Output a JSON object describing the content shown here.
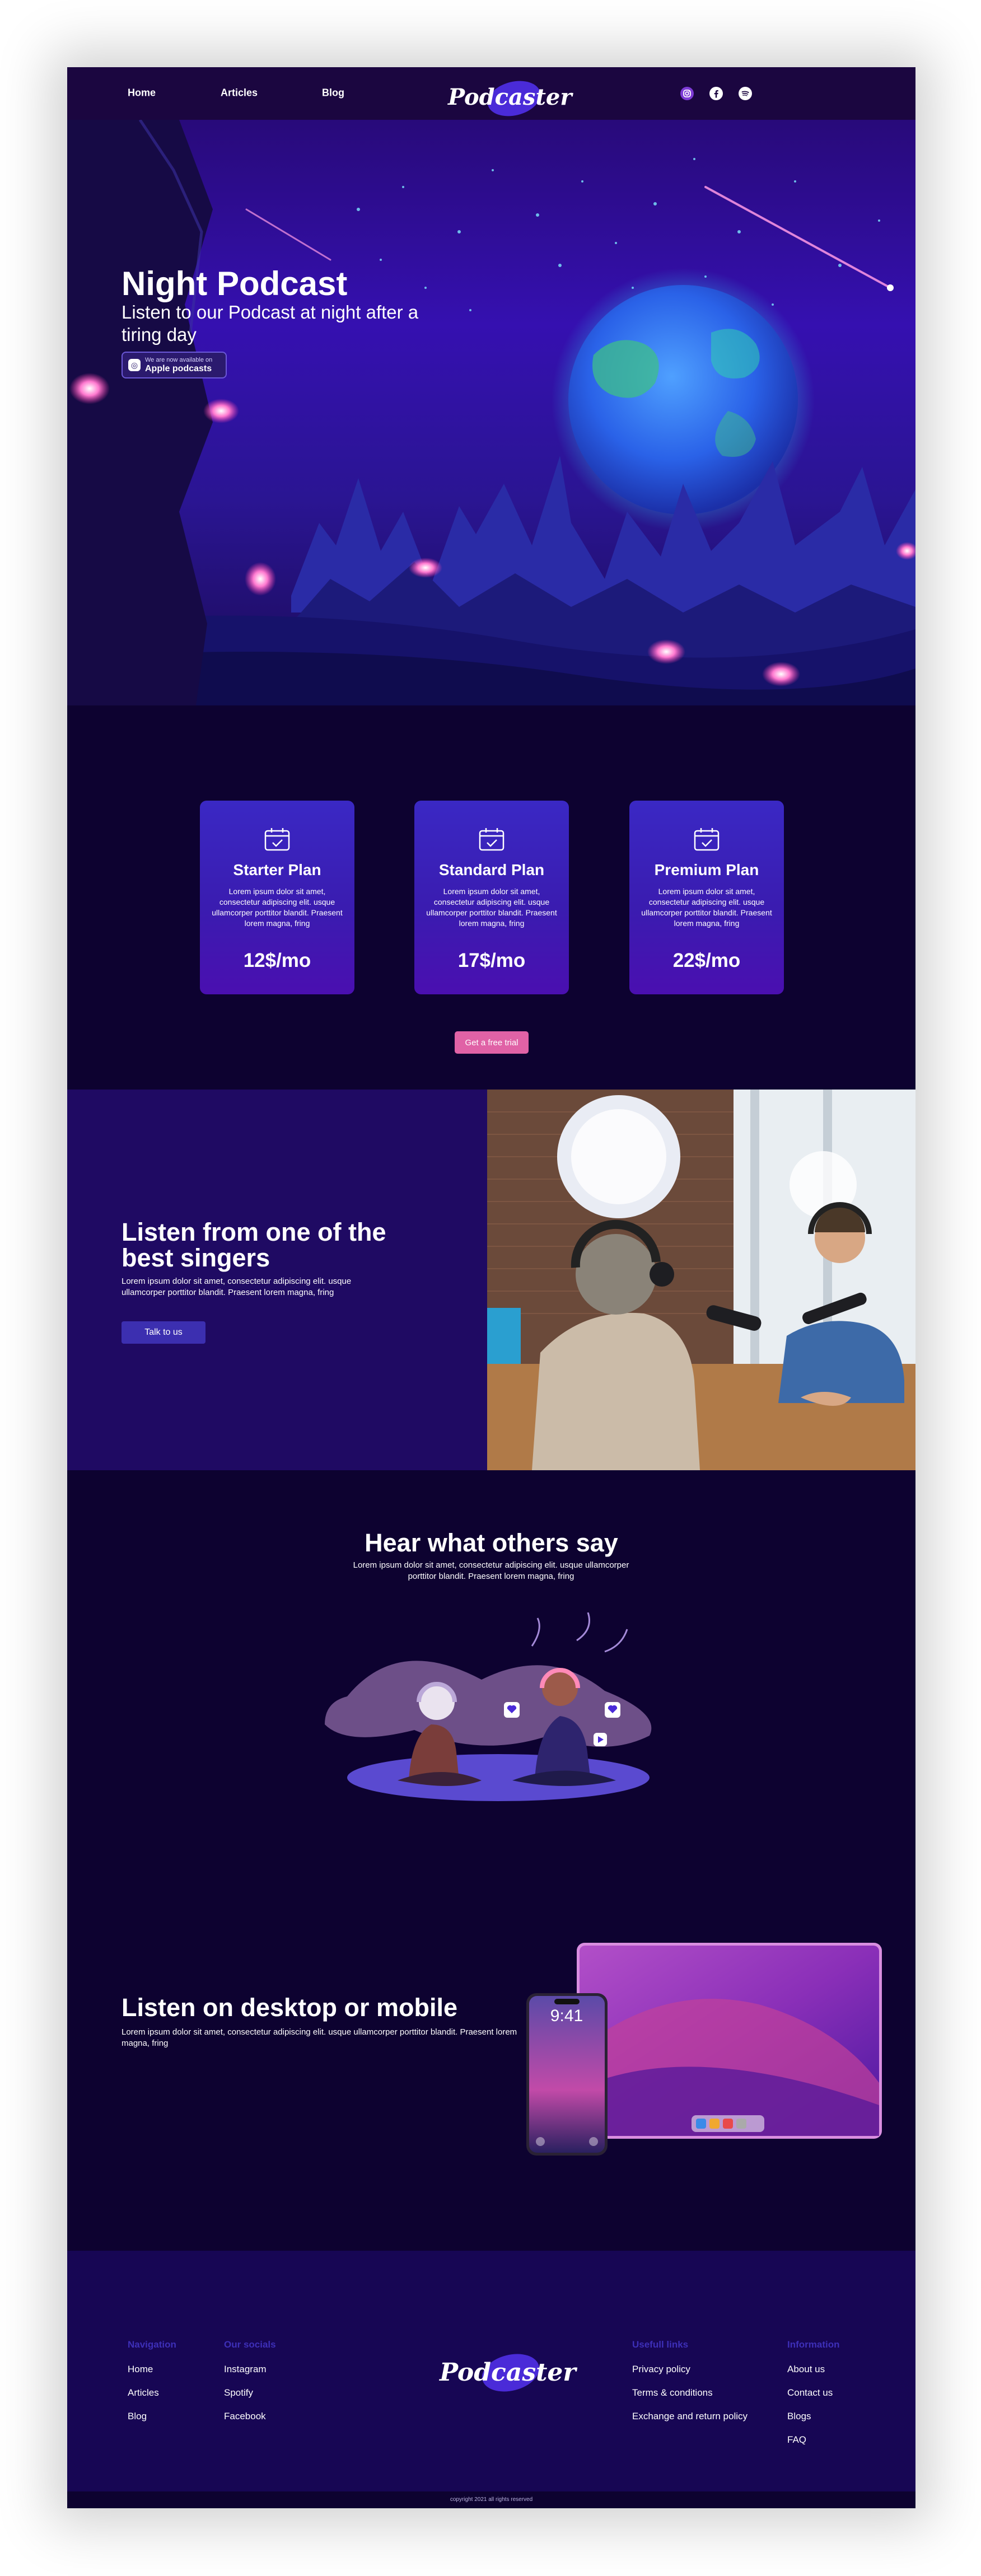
{
  "nav": {
    "links": [
      "Home",
      "Articles",
      "Blog"
    ],
    "brand": "Podcaster",
    "social_icons": [
      "instagram-icon",
      "facebook-icon",
      "spotify-icon"
    ]
  },
  "hero": {
    "title": "Night Podcast",
    "subtitle": "Listen to our Podcast at night after a tiring day",
    "badge_top": "We are now available on",
    "badge_main": "Apple podcasts"
  },
  "plans": [
    {
      "name": "Starter Plan",
      "desc": "Lorem ipsum dolor sit amet, consectetur adipiscing elit. usque ullamcorper porttitor blandit. Praesent lorem magna, fring",
      "price": "12$/mo"
    },
    {
      "name": "Standard Plan",
      "desc": "Lorem ipsum dolor sit amet, consectetur adipiscing elit. usque ullamcorper porttitor blandit. Praesent lorem magna, fring",
      "price": "17$/mo"
    },
    {
      "name": "Premium Plan",
      "desc": "Lorem ipsum dolor sit amet, consectetur adipiscing elit. usque ullamcorper porttitor blandit. Praesent lorem magna, fring",
      "price": "22$/mo"
    }
  ],
  "trial_button": "Get a free trial",
  "singers": {
    "title": "Listen from one of the best singers",
    "desc": "Lorem ipsum dolor sit amet, consectetur adipiscing elit. usque ullamcorper porttitor blandit. Praesent lorem magna, fring",
    "button": "Talk to us"
  },
  "reviews": {
    "title": "Hear what others say",
    "desc": "Lorem ipsum dolor sit amet, consectetur adipiscing elit. usque ullamcorper porttitor blandit. Praesent lorem magna, fring"
  },
  "devices": {
    "title": "Listen on desktop or mobile",
    "desc": "Lorem ipsum dolor sit amet, consectetur adipiscing elit. usque ullamcorper porttitor blandit. Praesent lorem magna, fring",
    "phone_time": "9:41"
  },
  "footer": {
    "brand": "Podcaster",
    "columns": [
      {
        "heading": "Navigation",
        "links": [
          "Home",
          "Articles",
          "Blog"
        ]
      },
      {
        "heading": "Our socials",
        "links": [
          "Instagram",
          "Spotify",
          "Facebook"
        ]
      },
      {
        "heading": "Usefull links",
        "links": [
          "Privacy policy",
          "Terms & conditions",
          "Exchange and return policy"
        ]
      },
      {
        "heading": "Information",
        "links": [
          "About us",
          "Contact us",
          "Blogs",
          "FAQ"
        ]
      }
    ],
    "copyright": "copyright 2021 all rights reserved"
  },
  "colors": {
    "background": "#0d0230",
    "nav": "#1b0640",
    "accent_pink": "#e062a6",
    "accent_blue": "#3c2fb0",
    "footer": "#170654"
  }
}
